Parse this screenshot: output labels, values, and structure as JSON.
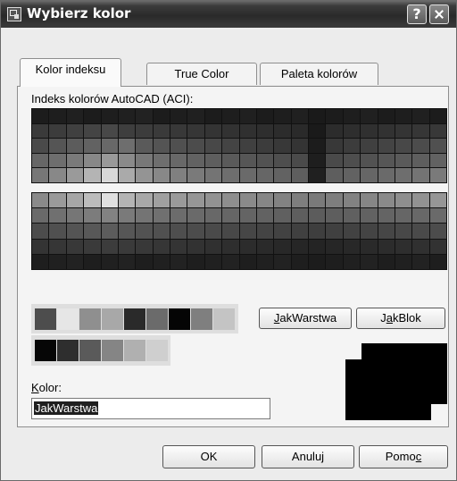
{
  "window": {
    "title": "Wybierz kolor",
    "help_button": "?",
    "close_button": "close"
  },
  "tabs": [
    {
      "label": "Kolor indeksu",
      "active": true
    },
    {
      "label": "True Color",
      "active": false
    },
    {
      "label": "Paleta kolorów",
      "active": false
    }
  ],
  "aci": {
    "label": "Indeks kolorów AutoCAD (ACI):",
    "top_grid": [
      [
        "#1c1c1c",
        "#1e1e1e",
        "#202020",
        "#1c1c1c",
        "#1e1e1e",
        "#202020",
        "#222222",
        "#1c1c1c",
        "#1e1e1e",
        "#202020",
        "#1c1c1c",
        "#1e1e1e",
        "#202020",
        "#1c1c1c",
        "#1e1e1e",
        "#202020",
        "#1a1a1a",
        "#1c1c1c",
        "#1e1e1e",
        "#202020",
        "#1c1c1c",
        "#1e1e1e",
        "#202020",
        "#1c1c1c"
      ],
      [
        "#3a3a3a",
        "#3c3c3c",
        "#404040",
        "#444444",
        "#484848",
        "#3e3e3e",
        "#3c3c3c",
        "#3a3a3a",
        "#383838",
        "#363636",
        "#343434",
        "#323232",
        "#303030",
        "#2e2e2e",
        "#2c2c2c",
        "#2a2a2a",
        "#1a1a1a",
        "#2c2c2c",
        "#2e2e2e",
        "#303030",
        "#323232",
        "#343434",
        "#363636",
        "#383838"
      ],
      [
        "#4a4a4a",
        "#555555",
        "#5c5c5c",
        "#626262",
        "#686868",
        "#6e6e6e",
        "#5a5a5a",
        "#545454",
        "#505050",
        "#4c4c4c",
        "#484848",
        "#444444",
        "#404040",
        "#3c3c3c",
        "#383838",
        "#343434",
        "#1c1c1c",
        "#383838",
        "#3c3c3c",
        "#404040",
        "#444444",
        "#484848",
        "#4c4c4c",
        "#505050"
      ],
      [
        "#666666",
        "#6e6e6e",
        "#7a7a7a",
        "#888888",
        "#999999",
        "#8a8a8a",
        "#787878",
        "#6e6e6e",
        "#686868",
        "#626262",
        "#5e5e5e",
        "#5a5a5a",
        "#565656",
        "#525252",
        "#4e4e4e",
        "#4a4a4a",
        "#1e1e1e",
        "#4a4a4a",
        "#4e4e4e",
        "#525252",
        "#565656",
        "#5a5a5a",
        "#5e5e5e",
        "#626262"
      ],
      [
        "#777777",
        "#888888",
        "#9a9a9a",
        "#b4b4b4",
        "#d8d8d8",
        "#aaaaaa",
        "#949494",
        "#888888",
        "#808080",
        "#7a7a7a",
        "#747474",
        "#6e6e6e",
        "#6a6a6a",
        "#666666",
        "#626262",
        "#5e5e5e",
        "#202020",
        "#5e5e5e",
        "#626262",
        "#666666",
        "#6a6a6a",
        "#6e6e6e",
        "#747474",
        "#7a7a7a"
      ]
    ],
    "bottom_grid": [
      [
        "#8a8a8a",
        "#9a9a9a",
        "#a6a6a6",
        "#bcbcbc",
        "#e0e0e0",
        "#b4b4b4",
        "#a8a8a8",
        "#a0a0a0",
        "#9a9a9a",
        "#969696",
        "#929292",
        "#8e8e8e",
        "#8a8a8a",
        "#868686",
        "#828282",
        "#7e7e7e",
        "#7a7a7a",
        "#7e7e7e",
        "#828282",
        "#868686",
        "#8a8a8a",
        "#8e8e8e",
        "#929292",
        "#969696"
      ],
      [
        "#6a6a6a",
        "#707070",
        "#767676",
        "#7c7c7c",
        "#828282",
        "#7a7a7a",
        "#747474",
        "#707070",
        "#6c6c6c",
        "#6a6a6a",
        "#686868",
        "#666666",
        "#646464",
        "#626262",
        "#606060",
        "#5e5e5e",
        "#5c5c5c",
        "#5e5e5e",
        "#606060",
        "#626262",
        "#646464",
        "#666666",
        "#686868",
        "#6a6a6a"
      ],
      [
        "#4c4c4c",
        "#505050",
        "#545454",
        "#585858",
        "#5c5c5c",
        "#565656",
        "#525252",
        "#505050",
        "#4e4e4e",
        "#4c4c4c",
        "#4a4a4a",
        "#484848",
        "#464646",
        "#444444",
        "#424242",
        "#404040",
        "#3e3e3e",
        "#404040",
        "#424242",
        "#444444",
        "#464646",
        "#484848",
        "#4a4a4a",
        "#4c4c4c"
      ],
      [
        "#343434",
        "#363636",
        "#383838",
        "#3a3a3a",
        "#3c3c3c",
        "#3a3a3a",
        "#383838",
        "#363636",
        "#343434",
        "#323232",
        "#303030",
        "#2e2e2e",
        "#2c2c2c",
        "#2a2a2a",
        "#282828",
        "#262626",
        "#242424",
        "#262626",
        "#282828",
        "#2a2a2a",
        "#2c2c2c",
        "#2e2e2e",
        "#303030",
        "#323232"
      ],
      [
        "#1e1e1e",
        "#202020",
        "#222222",
        "#1e1e1e",
        "#202020",
        "#222222",
        "#1e1e1e",
        "#202020",
        "#222222",
        "#1e1e1e",
        "#202020",
        "#222222",
        "#1e1e1e",
        "#202020",
        "#222222",
        "#1e1e1e",
        "#1c1c1c",
        "#1e1e1e",
        "#202020",
        "#222222",
        "#1e1e1e",
        "#202020",
        "#222222",
        "#1e1e1e"
      ]
    ]
  },
  "standard_colors": [
    "#4d4d4d",
    "#e6e6e6",
    "#8f8f8f",
    "#a8a8a8",
    "#2a2a2a",
    "#6b6b6b",
    "#050505",
    "#7f7f7f",
    "#c4c4c4"
  ],
  "gray_colors": [
    "#060606",
    "#2e2e2e",
    "#5a5a5a",
    "#858585",
    "#b0b0b0",
    "#cfcfcf"
  ],
  "buttons": {
    "bylayer_pre": "",
    "bylayer_ul": "J",
    "bylayer_post": "akWarstwa",
    "byblock_pre": "J",
    "byblock_ul": "a",
    "byblock_post": "kBlok",
    "ok": "OK",
    "cancel": "Anuluj",
    "help_pre": "Pomo",
    "help_ul": "c"
  },
  "color_field": {
    "label_ul": "K",
    "label_rest": "olor:",
    "value": "JakWarstwa"
  },
  "preview": {
    "current": "#000000",
    "previous": "#000000"
  }
}
